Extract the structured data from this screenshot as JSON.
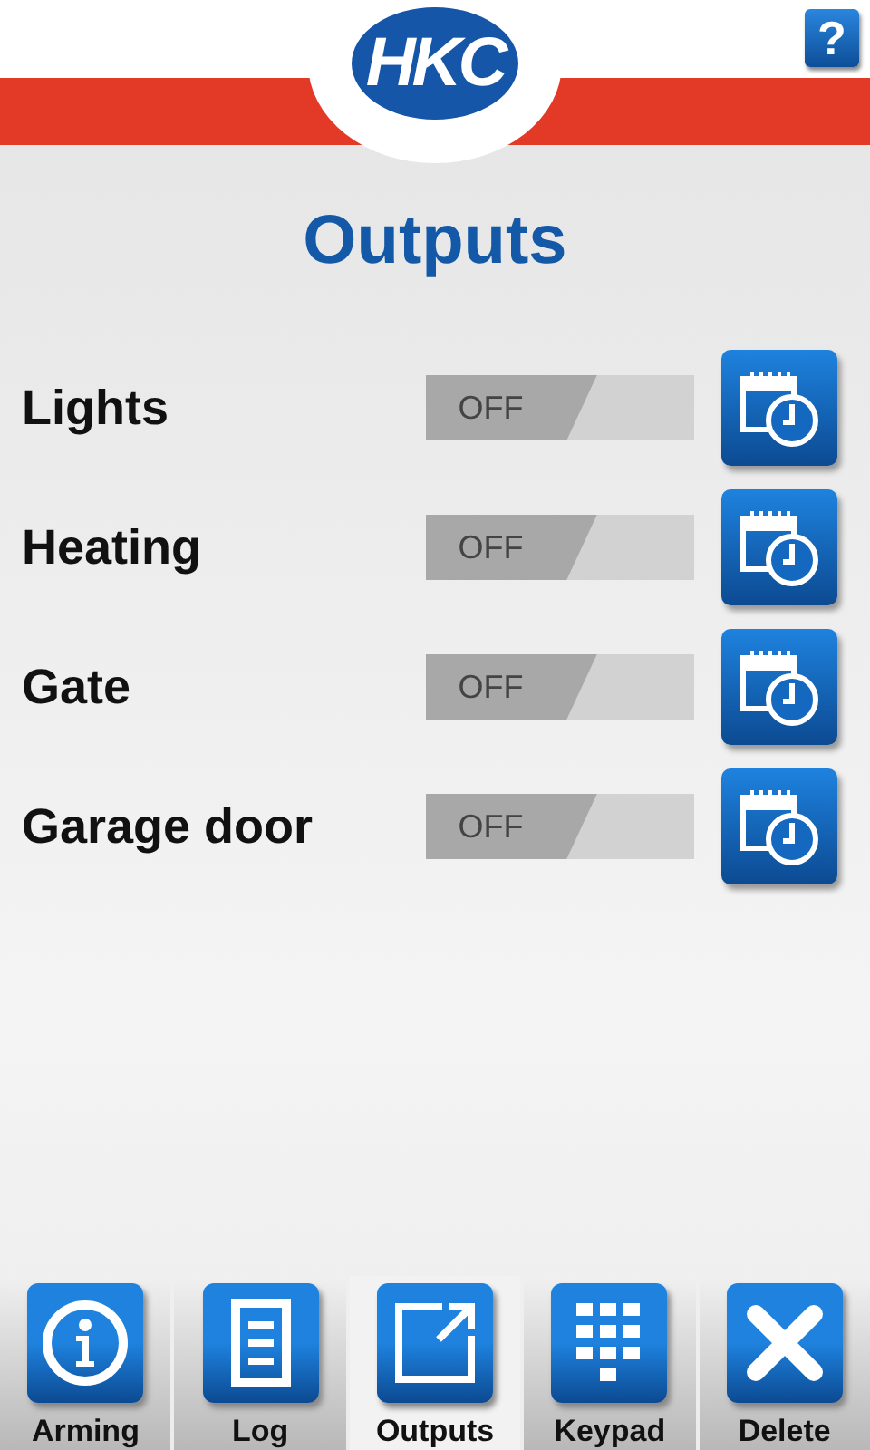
{
  "header": {
    "logo": "HKC",
    "help_button": "?"
  },
  "title": "Outputs",
  "outputs": [
    {
      "name": "Lights",
      "state": "OFF",
      "on": false
    },
    {
      "name": "Heating",
      "state": "OFF",
      "on": false
    },
    {
      "name": "Gate",
      "state": "OFF",
      "on": false
    },
    {
      "name": "Garage door",
      "state": "OFF",
      "on": false
    }
  ],
  "nav": [
    {
      "kind": "info",
      "label": "Arming",
      "selected": false
    },
    {
      "kind": "log",
      "label": "Log",
      "selected": false
    },
    {
      "kind": "outputs",
      "label": "Outputs",
      "selected": true
    },
    {
      "kind": "keypad",
      "label": "Keypad",
      "selected": false
    },
    {
      "kind": "delete",
      "label": "Delete",
      "selected": false
    }
  ]
}
